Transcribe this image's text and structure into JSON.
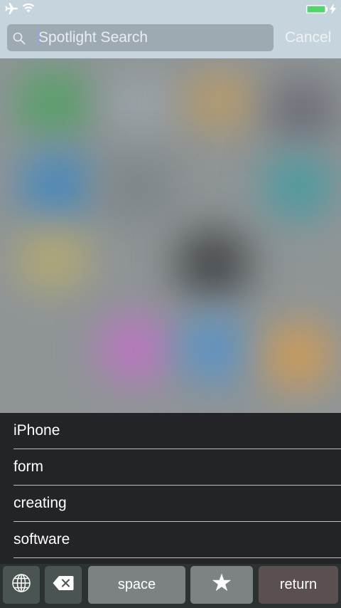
{
  "status_bar": {
    "airplane_icon": "airplane-icon",
    "wifi_icon": "wifi-icon",
    "battery_icon": "battery-icon",
    "battery_color": "#4cd964",
    "charging_icon": "charging-bolt-icon"
  },
  "search": {
    "placeholder": "Spotlight Search",
    "icon": "search-icon",
    "cancel_label": "Cancel"
  },
  "suggestions": [
    {
      "label": "iPhone"
    },
    {
      "label": "form"
    },
    {
      "label": "creating"
    },
    {
      "label": "software"
    }
  ],
  "keyboard": {
    "globe_icon": "globe-icon",
    "delete_icon": "delete-icon",
    "space_label": "space",
    "star_icon": "star-icon",
    "return_label": "return"
  }
}
